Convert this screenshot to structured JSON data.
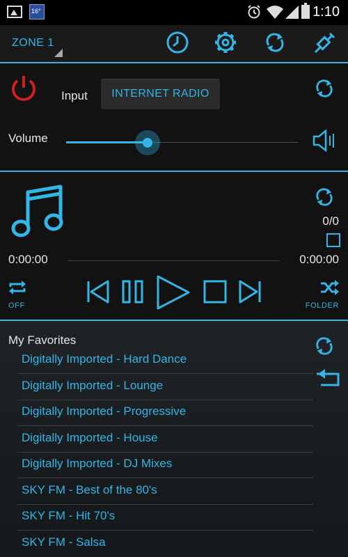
{
  "status_bar": {
    "time": "1:10",
    "weather_badge": "16°"
  },
  "toolbar": {
    "zone_label": "ZONE 1",
    "icons": [
      "clock-icon",
      "gear-icon",
      "refresh-icon",
      "connect-icon"
    ]
  },
  "input_section": {
    "input_label": "Input",
    "input_value": "INTERNET RADIO",
    "volume_label": "Volume",
    "volume_level": 0.35
  },
  "player": {
    "track_counter": "0/0",
    "elapsed": "0:00:00",
    "duration": "0:00:00",
    "repeat_label": "OFF",
    "shuffle_label": "FOLDER"
  },
  "favorites": {
    "title": "My Favorites",
    "items": [
      "Digitally Imported - Hard Dance",
      "Digitally Imported - Lounge",
      "Digitally Imported - Progressive",
      "Digitally Imported - House",
      "Digitally Imported - DJ Mixes",
      "SKY FM - Best of the 80's",
      "SKY FM - Hit 70's",
      "SKY FM - Salsa"
    ]
  },
  "colors": {
    "accent": "#33b5e5",
    "power": "#cc1f1f",
    "background": "#121212"
  }
}
